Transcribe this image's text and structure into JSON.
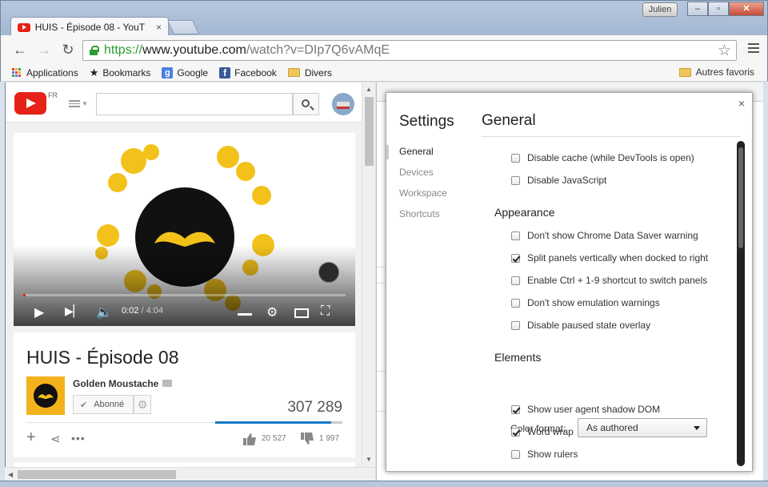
{
  "window": {
    "user_badge": "Julien",
    "tab_title": "HUIS - Épisode 08 - YouT",
    "tab_close": "×",
    "min": "‒",
    "max": "▫",
    "close": "✕"
  },
  "address": {
    "scheme": "https://",
    "host": "www.youtube.com",
    "path": "/watch?v=DIp7Q6vAMqE"
  },
  "bookmarks": {
    "items": [
      "Applications",
      "Bookmarks",
      "Google",
      "Facebook",
      "Divers"
    ],
    "right": "Autres favoris"
  },
  "youtube": {
    "locale": "FR",
    "search_placeholder": "",
    "time_current": "0:02",
    "time_separator": " / ",
    "time_duration": "4:04",
    "progress": 0.008,
    "title": "HUIS - Épisode 08",
    "channel": "Golden Moustache",
    "subscribe_label": "Abonné",
    "views": "307 289",
    "like_ratio": 0.911,
    "likes": "20 527",
    "dislikes": "1 997"
  },
  "settings": {
    "title": "Settings",
    "close": "×",
    "nav": [
      "General",
      "Devices",
      "Workspace",
      "Shortcuts"
    ],
    "active_nav": "General",
    "panel_title": "General",
    "options_top": [
      {
        "label": "Disable cache (while DevTools is open)",
        "checked": false
      },
      {
        "label": "Disable JavaScript",
        "checked": false
      }
    ],
    "appearance_title": "Appearance",
    "appearance": [
      {
        "label": "Don't show Chrome Data Saver warning",
        "checked": false
      },
      {
        "label": "Split panels vertically when docked to right",
        "checked": true
      },
      {
        "label": "Enable Ctrl + 1-9 shortcut to switch panels",
        "checked": false
      },
      {
        "label": "Don't show emulation warnings",
        "checked": false
      },
      {
        "label": "Disable paused state overlay",
        "checked": false
      }
    ],
    "elements_title": "Elements",
    "color_format_label": "Color format:",
    "color_format_value": "As authored",
    "elements": [
      {
        "label": "Show user agent shadow DOM",
        "checked": true
      },
      {
        "label": "Word wrap",
        "checked": true
      },
      {
        "label": "Show rulers",
        "checked": false
      }
    ]
  }
}
